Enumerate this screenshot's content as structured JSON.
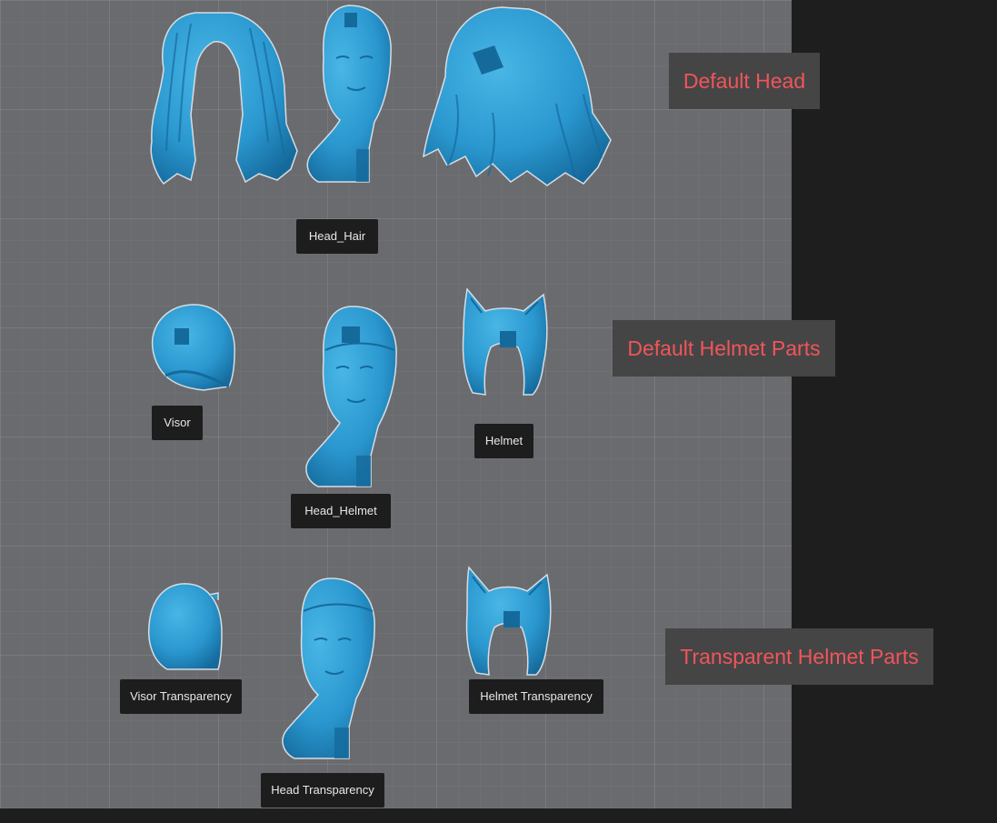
{
  "colors": {
    "model": "#2a97cf",
    "model_shadow": "#156a9c",
    "model_outline": "#d6dde2",
    "section_text": "#f0555a"
  },
  "sections": {
    "default_head": "Default Head",
    "default_helmet_parts": "Default Helmet Parts",
    "transparent_helmet_parts": "Transparent Helmet Parts"
  },
  "labels": {
    "head_hair": "Head_Hair",
    "visor": "Visor",
    "head_helmet": "Head_Helmet",
    "helmet": "Helmet",
    "visor_transparency": "Visor Transparency",
    "head_transparency": "Head Transparency",
    "helmet_transparency": "Helmet Transparency"
  },
  "models": {
    "hair_front": "hair-model",
    "head_hair": "head-bust-model",
    "hair_back": "hair-model",
    "visor": "visor-model",
    "head_helmet": "head-bust-model",
    "helmet": "cat-ear-helmet-model",
    "visor_transparency": "visor-model",
    "head_transparency": "head-bust-model",
    "helmet_transparency": "cat-ear-helmet-model"
  }
}
